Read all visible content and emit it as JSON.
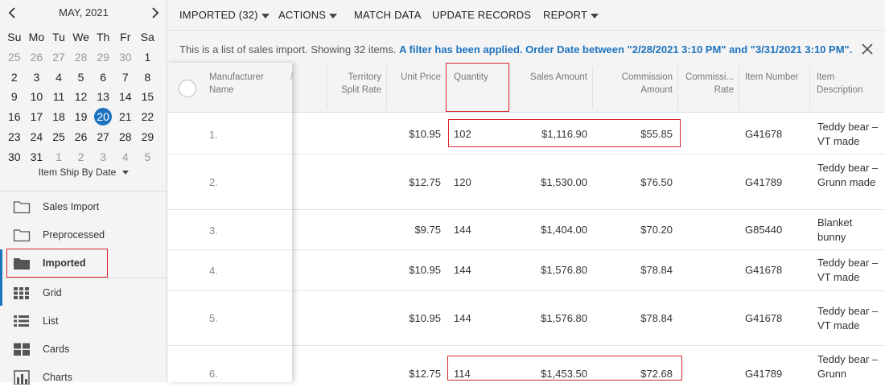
{
  "calendar": {
    "title": "MAY, 2021",
    "prev_icon": "chevron-left-icon",
    "next_icon": "chevron-right-icon",
    "weekdays": [
      "Su",
      "Mo",
      "Tu",
      "We",
      "Th",
      "Fr",
      "Sa"
    ],
    "weeks": [
      [
        "25",
        "26",
        "27",
        "28",
        "29",
        "30",
        "1"
      ],
      [
        "2",
        "3",
        "4",
        "5",
        "6",
        "7",
        "8"
      ],
      [
        "9",
        "10",
        "11",
        "12",
        "13",
        "14",
        "15"
      ],
      [
        "16",
        "17",
        "18",
        "19",
        "20",
        "21",
        "22"
      ],
      [
        "23",
        "24",
        "25",
        "26",
        "27",
        "28",
        "29"
      ],
      [
        "30",
        "31",
        "1",
        "2",
        "3",
        "4",
        "5"
      ]
    ],
    "selected": "20",
    "date_field": "Item Ship By Date"
  },
  "sidebar": {
    "folders": [
      {
        "label": "Sales Import",
        "icon": "folder-outline-icon"
      },
      {
        "label": "Preprocessed",
        "icon": "folder-outline-icon"
      },
      {
        "label": "Imported",
        "icon": "folder-filled-icon",
        "active": true
      }
    ],
    "views": [
      {
        "label": "Grid",
        "icon": "grid-icon",
        "active": true
      },
      {
        "label": "List",
        "icon": "list-icon"
      },
      {
        "label": "Cards",
        "icon": "cards-icon"
      },
      {
        "label": "Charts",
        "icon": "bar-chart-icon"
      }
    ]
  },
  "toolbar": {
    "imported_label": "IMPORTED (32)",
    "actions_label": "ACTIONS",
    "match_label": "MATCH DATA",
    "update_label": "UPDATE RECORDS",
    "report_label": "REPORT"
  },
  "info": {
    "text": "This is a list of sales import. Showing 32 items.",
    "filter_text": "A filter has been applied. Order Date between \"2/28/2021 3:10 PM\" and \"3/31/2021 3:10 PM\"."
  },
  "table": {
    "headers": {
      "manufacturer": "Manufacturer Name",
      "territory": "Territory Split Rate",
      "unit_price": "Unit Price",
      "quantity": "Quantity",
      "sales_amount": "Sales Amount",
      "commission_amount": "Commission Amount",
      "commission_rate": "Commissi... Rate",
      "item_number": "Item Number",
      "item_description": "Item Description"
    },
    "rows": [
      {
        "num": "1.",
        "unit_price": "$10.95",
        "quantity": "102",
        "sales": "$1,116.90",
        "commission": "$55.85",
        "item": "G41678",
        "desc": "Teddy bear – VT made"
      },
      {
        "num": "2.",
        "unit_price": "$12.75",
        "quantity": "120",
        "sales": "$1,530.00",
        "commission": "$76.50",
        "item": "G41789",
        "desc": "Teddy bear – Grunn made"
      },
      {
        "num": "3.",
        "unit_price": "$9.75",
        "quantity": "144",
        "sales": "$1,404.00",
        "commission": "$70.20",
        "item": "G85440",
        "desc": "Blanket bunny"
      },
      {
        "num": "4.",
        "unit_price": "$10.95",
        "quantity": "144",
        "sales": "$1,576.80",
        "commission": "$78.84",
        "item": "G41678",
        "desc": "Teddy bear – VT made"
      },
      {
        "num": "5.",
        "unit_price": "$10.95",
        "quantity": "144",
        "sales": "$1,576.80",
        "commission": "$78.84",
        "item": "G41678",
        "desc": "Teddy bear – VT made"
      },
      {
        "num": "6.",
        "unit_price": "$12.75",
        "quantity": "114",
        "sales": "$1,453.50",
        "commission": "$72.68",
        "item": "G41789",
        "desc": "Teddy bear – Grunn"
      }
    ]
  },
  "colors": {
    "accent": "#1e73be",
    "highlight_box": "#d6262b",
    "panel_bg": "#f4f4f4"
  }
}
